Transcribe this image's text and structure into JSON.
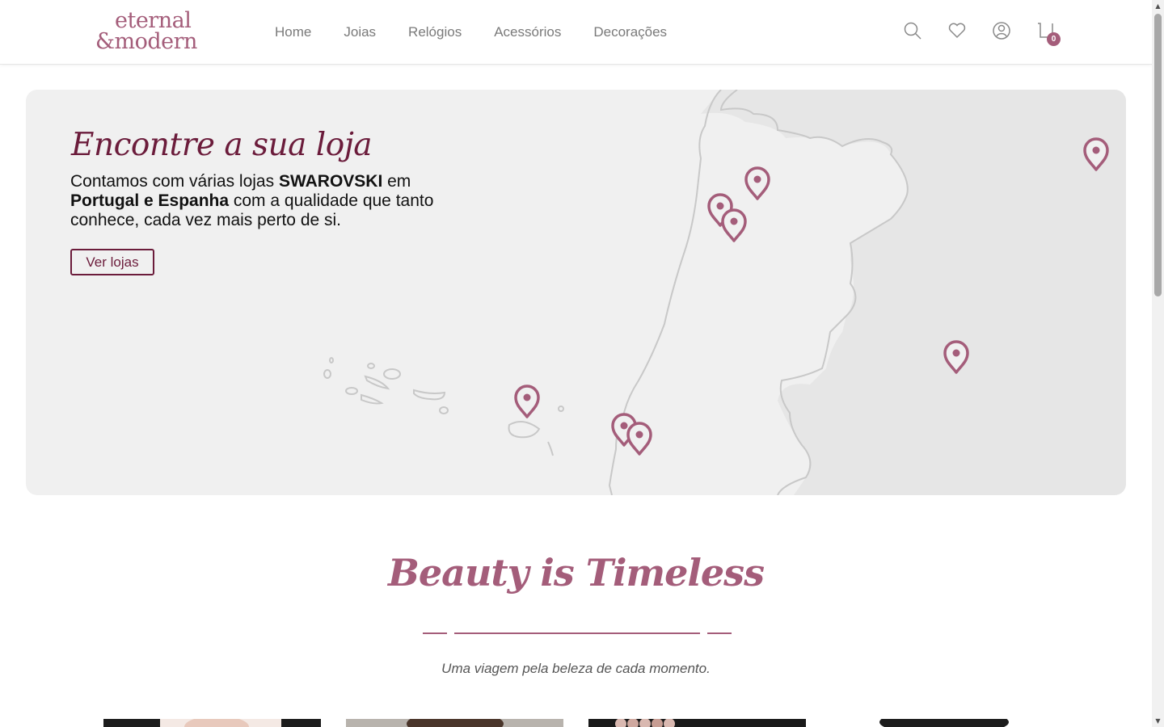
{
  "logo": {
    "line1": "eternal",
    "line2": "&modern"
  },
  "nav": [
    "Home",
    "Joias",
    "Relógios",
    "Acessórios",
    "Decorações"
  ],
  "header_icons": [
    "search-icon",
    "heart-icon",
    "user-icon",
    "cart-icon"
  ],
  "cart": {
    "count": "0"
  },
  "banner": {
    "title": "Encontre a sua loja",
    "text_1": "Contamos com várias lojas ",
    "text_brand": "SWAROVSKI",
    "text_2": " em ",
    "text_countries": "Portugal e Espanha",
    "text_3": " com a qualidade que tanto conhece, cada vez mais perto de si.",
    "button": "Ver lojas"
  },
  "beauty": {
    "title": "Beauty is Timeless",
    "subtitle": "Uma viagem pela beleza de cada momento."
  },
  "colors": {
    "accent": "#a45d7a",
    "dark_accent": "#6b1c3b",
    "banner_bg": "#f0f0f0",
    "map_outline": "#c8c8c8",
    "nav_text": "#7a7a7a"
  }
}
